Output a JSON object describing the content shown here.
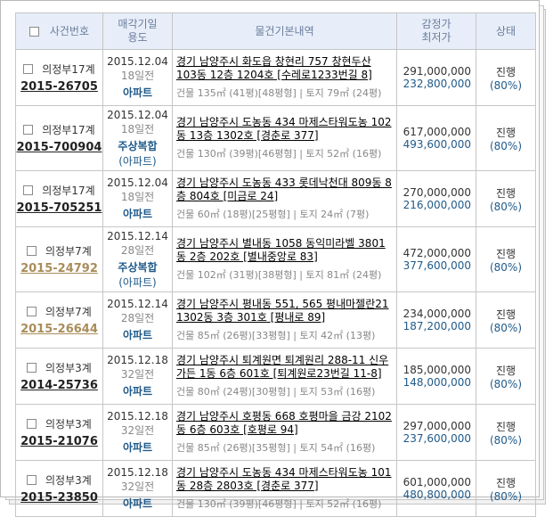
{
  "header": {
    "case_no": "사건번호",
    "sale_date_line1": "매각기일",
    "sale_date_line2": "용도",
    "property": "물건기본내역",
    "price_line1": "감정가",
    "price_line2": "최저가",
    "status": "상태"
  },
  "rows": [
    {
      "court": "의정부17계",
      "case_no": "2015-26705",
      "case_color": "normal",
      "date": "2015.12.04",
      "days": "18일전",
      "usage1": "아파트",
      "usage2": "",
      "address": "경기 남양주시 화도읍 창현리 757 창현두산 103동 12층 1204호 [수레로1233번길 8]",
      "area": "건물 135㎡ (41평)[48평형] | 토지 79㎡ (24평)",
      "appraisal": "291,000,000",
      "minimum": "232,800,000",
      "status": "진행",
      "percent": "(80%)"
    },
    {
      "court": "의정부17계",
      "case_no": "2015-700904",
      "case_color": "normal",
      "date": "2015.12.04",
      "days": "18일전",
      "usage1": "주상복합",
      "usage2": "(아파트)",
      "address": "경기 남양주시 도농동 434 마제스타워도농 102동 13층 1302호 [경춘로 377]",
      "area": "건물 130㎡ (39평)[46평형] | 토지 52㎡ (16평)",
      "appraisal": "617,000,000",
      "minimum": "493,600,000",
      "status": "진행",
      "percent": "(80%)"
    },
    {
      "court": "의정부17계",
      "case_no": "2015-705251",
      "case_color": "normal",
      "date": "2015.12.04",
      "days": "18일전",
      "usage1": "아파트",
      "usage2": "",
      "address": "경기 남양주시 도농동 433 롯데낙천대 809동 8층 804호 [미금로 24]",
      "area": "건물 60㎡ (18평)[25평형] | 토지 24㎡ (7평)",
      "appraisal": "270,000,000",
      "minimum": "216,000,000",
      "status": "진행",
      "percent": "(80%)"
    },
    {
      "court": "의정부7계",
      "case_no": "2015-24792",
      "case_color": "gold",
      "date": "2015.12.14",
      "days": "28일전",
      "usage1": "주상복합",
      "usage2": "(아파트)",
      "address": "경기 남양주시 별내동 1058 동익미라벨 3801동 2층 202호 [별내중앙로 83]",
      "area": "건물 102㎡ (31평)[38평형] | 토지 81㎡ (24평)",
      "appraisal": "472,000,000",
      "minimum": "377,600,000",
      "status": "진행",
      "percent": "(80%)"
    },
    {
      "court": "의정부7계",
      "case_no": "2015-26644",
      "case_color": "gold",
      "date": "2015.12.14",
      "days": "28일전",
      "usage1": "아파트",
      "usage2": "",
      "address": "경기 남양주시 평내동 551, 565 평내마젤란21 1302동 3층 301호 [평내로 89]",
      "area": "건물 85㎡ (26평)[33평형] | 토지 42㎡ (13평)",
      "appraisal": "234,000,000",
      "minimum": "187,200,000",
      "status": "진행",
      "percent": "(80%)"
    },
    {
      "court": "의정부3계",
      "case_no": "2014-25736",
      "case_color": "normal",
      "date": "2015.12.18",
      "days": "32일전",
      "usage1": "아파트",
      "usage2": "",
      "address": "경기 남양주시 퇴계원면 퇴계원리 288-11 신우가든 1동 6층 601호 [퇴계원로23번길 11-8]",
      "area": "건물 80㎡ (24평)[30평형] | 토지 53㎡ (16평)",
      "appraisal": "185,000,000",
      "minimum": "148,000,000",
      "status": "진행",
      "percent": "(80%)"
    },
    {
      "court": "의정부3계",
      "case_no": "2015-21076",
      "case_color": "normal",
      "date": "2015.12.18",
      "days": "32일전",
      "usage1": "아파트",
      "usage2": "",
      "address": "경기 남양주시 호평동 668 호평마을 금강 2102동 6층 603호 [호평로 94]",
      "area": "건물 85㎡ (26평)[35평형] | 토지 54㎡ (16평)",
      "appraisal": "297,000,000",
      "minimum": "237,600,000",
      "status": "진행",
      "percent": "(80%)"
    },
    {
      "court": "의정부3계",
      "case_no": "2015-23850",
      "case_color": "normal",
      "date": "2015.12.18",
      "days": "32일전",
      "usage1": "아파트",
      "usage2": "",
      "address": "경기 남양주시 도농동 434 마제스타워도농 101동 28층 2803호 [경춘로 377]",
      "area": "건물 130㎡ (39평)[46평형] | 토지 52㎡ (16평)",
      "appraisal": "601,000,000",
      "minimum": "480,800,000",
      "status": "진행",
      "percent": "(80%)"
    }
  ]
}
